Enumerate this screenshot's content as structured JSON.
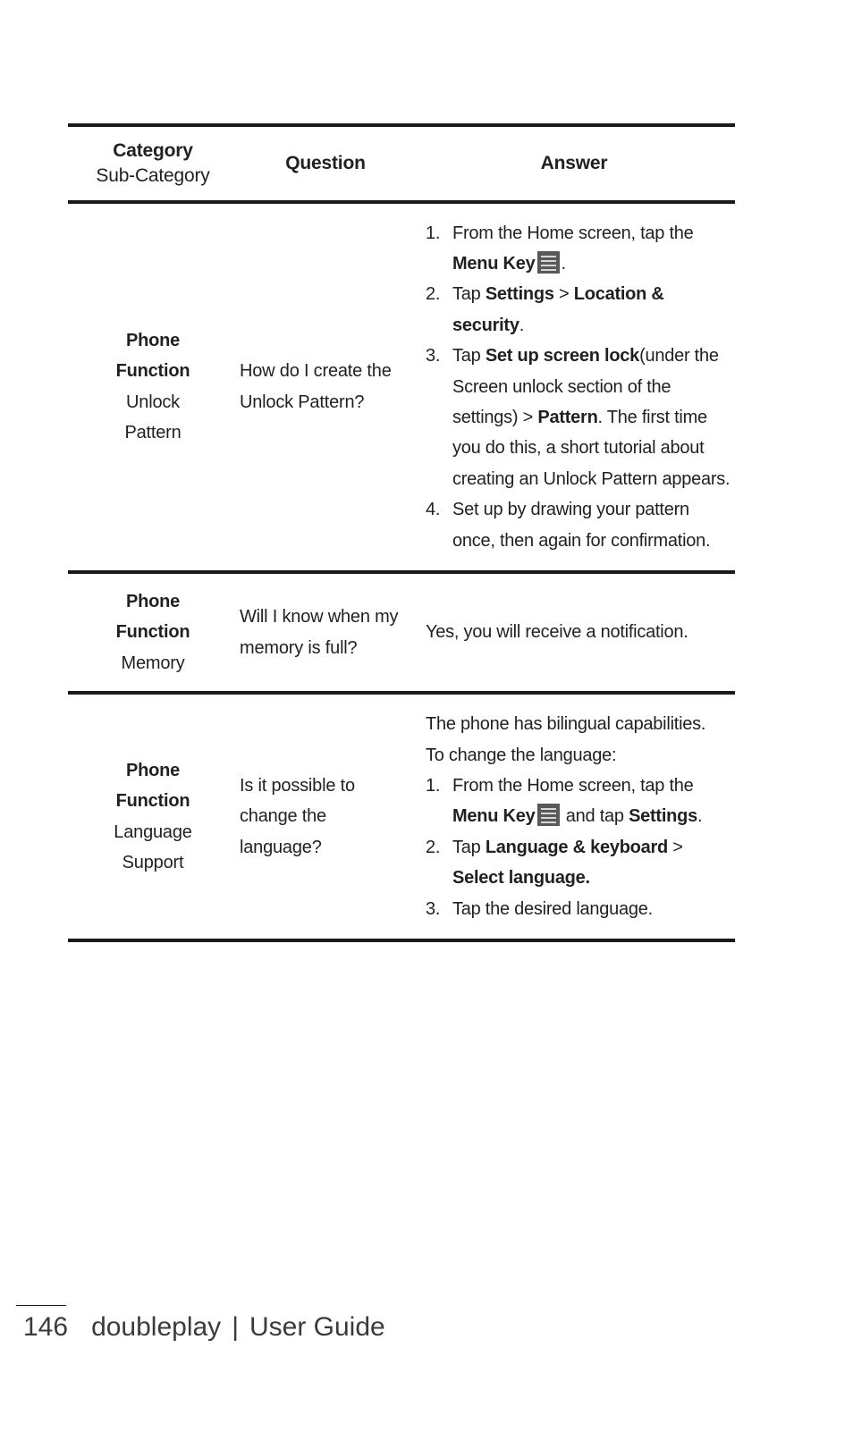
{
  "table": {
    "headers": {
      "category_main": "Category",
      "category_sub": "Sub-Category",
      "question": "Question",
      "answer": "Answer"
    },
    "rows": [
      {
        "category_main_line1": "Phone",
        "category_main_line2": "Function",
        "category_sub_line1": "Unlock",
        "category_sub_line2": "Pattern",
        "question": "How do I create the Unlock Pattern?",
        "answer_steps": [
          {
            "num": "1.",
            "parts": [
              {
                "t": "From the Home screen, tap the ",
                "b": false
              },
              {
                "t": "Menu Key",
                "b": true
              },
              {
                "t": "icon",
                "icon": true
              },
              {
                "t": ".",
                "b": false
              }
            ]
          },
          {
            "num": "2.",
            "parts": [
              {
                "t": "Tap ",
                "b": false
              },
              {
                "t": "Settings",
                "b": true
              },
              {
                "t": " > ",
                "b": false
              },
              {
                "t": "Location & security",
                "b": true
              },
              {
                "t": ".",
                "b": false
              }
            ]
          },
          {
            "num": "3.",
            "parts": [
              {
                "t": "Tap ",
                "b": false
              },
              {
                "t": "Set up screen lock",
                "b": true
              },
              {
                "t": "(under the Screen unlock section of the settings) > ",
                "b": false
              },
              {
                "t": "Pattern",
                "b": true
              },
              {
                "t": ". The first time you do this, a short tutorial about creating an Unlock Pattern appears.",
                "b": false
              }
            ]
          },
          {
            "num": "4.",
            "parts": [
              {
                "t": "Set up by drawing your pattern once, then again for confirmation.",
                "b": false
              }
            ]
          }
        ]
      },
      {
        "category_main_line1": "Phone",
        "category_main_line2": "Function",
        "category_sub_line1": "Memory",
        "category_sub_line2": "",
        "question": "Will I know when my memory is full?",
        "answer_paragraphs": [
          "Yes, you will receive a notification."
        ]
      },
      {
        "category_main_line1": "Phone",
        "category_main_line2": "Function",
        "category_sub_line1": "Language",
        "category_sub_line2": "Support",
        "question": "Is it possible to change the language?",
        "answer_paragraphs": [
          "The phone has bilingual capabilities.",
          "To change the language:"
        ],
        "answer_steps": [
          {
            "num": "1.",
            "parts": [
              {
                "t": "From the Home screen, tap the ",
                "b": false
              },
              {
                "t": "Menu Key",
                "b": true
              },
              {
                "t": "icon",
                "icon": true
              },
              {
                "t": " and tap ",
                "b": false
              },
              {
                "t": "Settings",
                "b": true
              },
              {
                "t": ".",
                "b": false
              }
            ]
          },
          {
            "num": "2.",
            "parts": [
              {
                "t": "Tap ",
                "b": false
              },
              {
                "t": "Language & keyboard",
                "b": true
              },
              {
                "t": " > ",
                "b": false
              },
              {
                "t": "Select language.",
                "b": true
              }
            ]
          },
          {
            "num": "3.",
            "parts": [
              {
                "t": "Tap the desired language.",
                "b": false
              }
            ]
          }
        ]
      }
    ]
  },
  "footer": {
    "page_number": "146",
    "product": "doubleplay",
    "separator": "|",
    "doc_type": "User Guide"
  },
  "icons": {
    "menu_key": "menu-key-icon"
  },
  "colors": {
    "text": "#231f20",
    "rule": "#1a1a1a",
    "icon_bg": "#595959",
    "icon_lines": "#d6d6d6",
    "footer_text": "#3b3b3b",
    "page_bg": "#ffffff"
  }
}
